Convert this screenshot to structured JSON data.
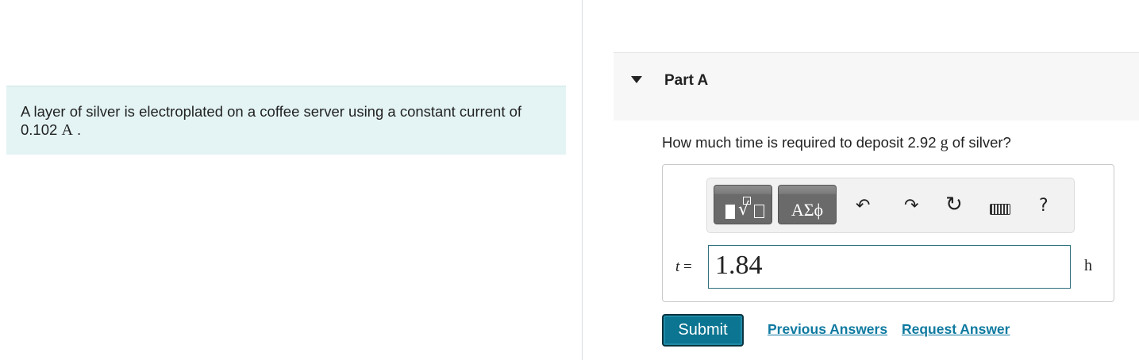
{
  "problem": {
    "text": "A layer of silver is electroplated on a coffee server using a constant current of",
    "value": "0.102",
    "unit": "A",
    "end": "."
  },
  "part": {
    "title": "Part A"
  },
  "question": {
    "before": "How much time is required to deposit 2.92",
    "unit": "g",
    "after": "of silver?"
  },
  "toolbar": {
    "templates_icon": "templates-icon",
    "symbols_label": "ΑΣϕ",
    "undo_icon": "undo-icon",
    "redo_icon": "redo-icon",
    "reset_icon": "reset-icon",
    "keyboard_icon": "keyboard-icon",
    "help_label": "?"
  },
  "answer": {
    "variable": "t",
    "equals": "=",
    "value": "1.84",
    "unit": "h"
  },
  "actions": {
    "submit_label": "Submit",
    "previous_label": "Previous Answers",
    "request_label": "Request Answer"
  },
  "colors": {
    "problem_bg": "#e4f4f4",
    "submit_bg": "#0c7591",
    "link": "#0f7aa0"
  }
}
